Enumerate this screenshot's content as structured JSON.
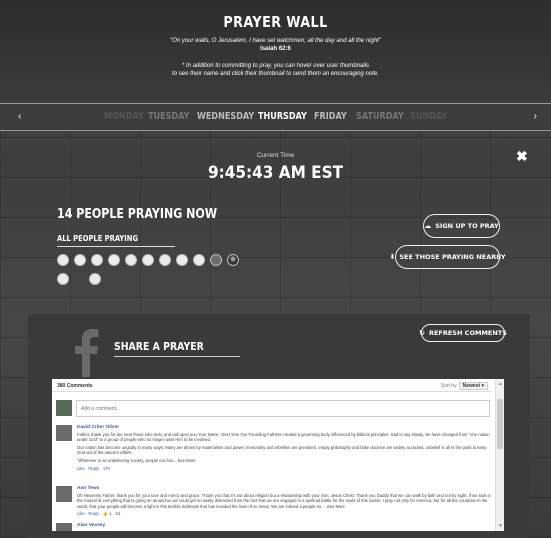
{
  "header": {
    "title": "PRAYER WALL",
    "verse": "\"On your walls, O Jerusalem, I have set watchmen; all the day and all the night\"",
    "verse_ref": "Isaiah 62:6",
    "note_line1": "* In addition to committing to pray, you can hover over user thumbnails",
    "note_line2": "to see their name and click their thumbnail to send them an encouraging note."
  },
  "day_nav": {
    "prev_icon": "chevron-left-icon",
    "next_icon": "chevron-right-icon",
    "prev_glyph": "‹",
    "next_glyph": "›",
    "days": [
      "MONDAY",
      "TUESDAY",
      "WEDNESDAY",
      "THURSDAY",
      "FRIDAY",
      "SATURDAY",
      "SUNDAY"
    ],
    "selected": "THURSDAY"
  },
  "clock": {
    "label": "Current Time",
    "time": "9:45:43 AM  EST"
  },
  "close_glyph": "✖",
  "praying": {
    "count_text": "14 PEOPLE PRAYING NOW",
    "all_label": "ALL PEOPLE PRAYING"
  },
  "buttons": {
    "signup": "SIGN UP TO PRAY",
    "see_nearby": "SEE THOSE PRAYING NEARBY",
    "refresh": "REFRESH COMMENTS"
  },
  "share": {
    "title": "SHARE A PRAYER"
  },
  "comments": {
    "count_label": "380 Comments",
    "sort_label": "Sort by",
    "sort_value": "Newest ▾",
    "input_placeholder": "Add a comment...",
    "items": [
      {
        "name": "David Criter Oliver",
        "paragraphs": [
          "Father, thank you for are near those who trust, and call upon you Your Name. Over time Our Founding Fathers created a governing body influenced by biblical principles. Sad to say slowly, we have changed from \"one nation under God\" to a group of people who no longer want Him to be involved.",
          "Our nation has become ungodly in many ways: Many are driven by materialism and power, immorality and rebellion are prevalent, empty philosophy and false doctrine are widely accepted, unbelief is all in the push to keep God out of the nation's affairs.",
          "\"Wherever in an unbelieving society, people can fan... See More"
        ],
        "meta": "Like · Reply · 17h"
      },
      {
        "name": "Ann Tews",
        "paragraphs": [
          "Oh Heavenly Father, thank you for your love and mercy and grace. Thank you that it's not about religion but a relationship with your Son, Jesus Christ. Thank you Daddy that we can walk by faith and not by sight. If we look in the natural at everything that is going on around us we could get so easily distracted from the fact that we are engaged in a spiritual battle for the souls of this nation. I pray not only for America, but for all the countries in the world, that your people will become a light in this terrible darkness that has invaded the lives of so many. We are indeed a people so ... See More"
        ],
        "meta": "Like · Reply · 👍 1 · 3d"
      },
      {
        "name": "Alan Vessey",
        "paragraphs": [],
        "meta": ""
      }
    ]
  }
}
